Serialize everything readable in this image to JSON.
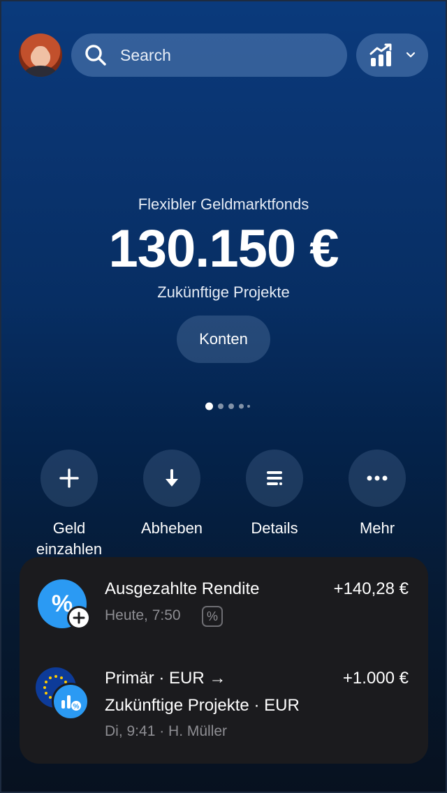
{
  "header": {
    "search_placeholder": "Search",
    "avatar_label": "user-avatar",
    "stats_icon": "chart-growth-icon"
  },
  "hero": {
    "account_label": "Flexibler Geldmarktfonds",
    "amount": "130.150 €",
    "subtitle": "Zukünftige Projekte",
    "accounts_button": "Konten",
    "pager": {
      "total": 5,
      "active": 0
    }
  },
  "actions": [
    {
      "label": "Geld einzahlen",
      "icon": "plus-icon"
    },
    {
      "label": "Abheben",
      "icon": "arrow-down-icon"
    },
    {
      "label": "Details",
      "icon": "list-icon"
    },
    {
      "label": "Mehr",
      "icon": "more-icon"
    }
  ],
  "transactions": [
    {
      "title": "Ausgezahlte Rendite",
      "amount": "+140,28 €",
      "meta": "Heute, 7:50",
      "chip": "%",
      "icon": "percent-icon"
    },
    {
      "title_line1": "Primär · EUR →",
      "title_line2": "Zukünftige Projekte · EUR",
      "amount": "+1.000 €",
      "meta": "Di, 9:41 · H. Müller",
      "icon": "eu-flag-icon"
    }
  ],
  "colors": {
    "accent_blue": "#2b9af3",
    "card_bg": "#1b1b1e",
    "muted_text": "#8e8e93"
  }
}
